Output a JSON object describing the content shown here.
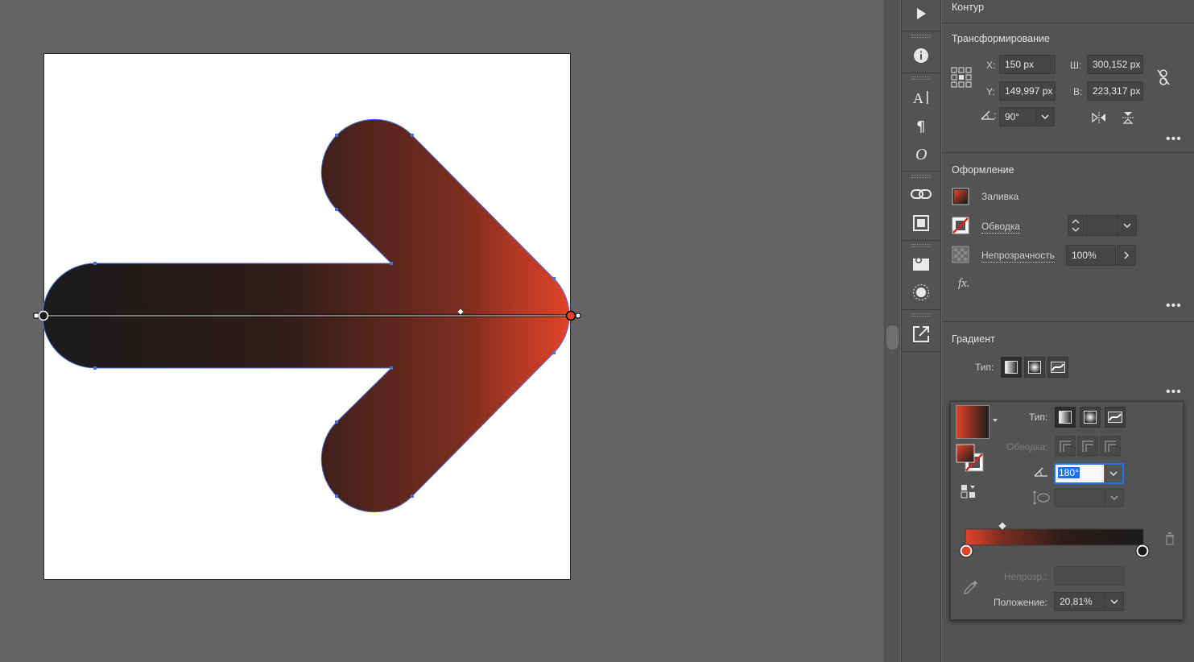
{
  "panel": {
    "top_section": "Контур",
    "transform": {
      "title": "Трансформирование",
      "x_label": "X:",
      "x_value": "150 px",
      "y_label": "Y:",
      "y_value": "149,997 px",
      "w_label": "Ш:",
      "w_value": "300,152 px",
      "h_label": "В:",
      "h_value": "223,317 px",
      "angle_value": "90°"
    },
    "appearance": {
      "title": "Оформление",
      "fill_label": "Заливка",
      "stroke_label": "Обводка",
      "opacity_label": "Непрозрачность",
      "opacity_value": "100%",
      "fx_label": "fx."
    },
    "gradient": {
      "title": "Градиент",
      "type_label": "Тип:"
    }
  },
  "gradient_panel": {
    "type_label": "Тип:",
    "stroke_label": "Обводка:",
    "angle_value": "180°",
    "opacity_label": "Непрозр.:",
    "position_label": "Положение:",
    "position_value": "20,81%",
    "stop_colors": [
      "#e4432a",
      "#1b1b1b"
    ]
  },
  "colors": {
    "accent_orange": "#e4432a",
    "dark": "#1b1b1b",
    "selection_blue": "#4a6ee0",
    "focus_blue": "#1a73e8"
  },
  "tools": [
    "play-icon",
    "info-icon",
    "character-icon",
    "paragraph-icon",
    "opentype-icon",
    "links-icon",
    "artboards-icon",
    "asset-export-icon",
    "appearance-icon",
    "export-icon"
  ]
}
